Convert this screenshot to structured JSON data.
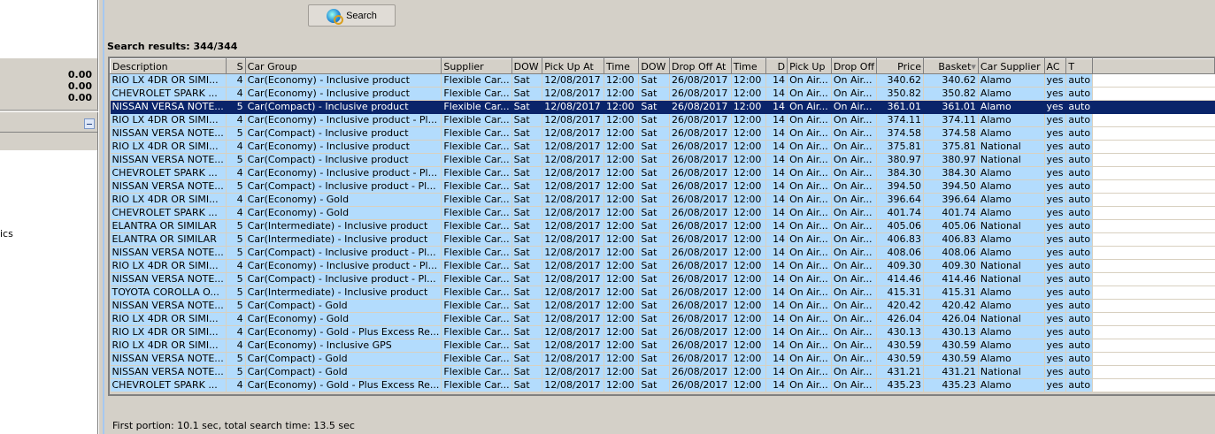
{
  "left_panel": {
    "values": [
      "0.00",
      "0.00",
      "0.00"
    ],
    "partial_label": "ics"
  },
  "toolbar": {
    "search_label": "Search",
    "search_icon": "globe-search-icon"
  },
  "results": {
    "label": "Search results: 344/344"
  },
  "table": {
    "columns": [
      "Description",
      "S",
      "Car Group",
      "Supplier",
      "DOW",
      "Pick Up At",
      "Time",
      "DOW",
      "Drop Off At",
      "Time",
      "D",
      "Pick Up",
      "Drop Off",
      "Price",
      "Basket",
      "Car Supplier",
      "AC",
      "T"
    ],
    "sorted_column": "Basket",
    "selected_row": 2,
    "rows": [
      [
        "RIO LX 4DR OR SIMI...",
        "4",
        "Car(Economy) - Inclusive product",
        "Flexible Car...",
        "Sat",
        "12/08/2017",
        "12:00",
        "Sat",
        "26/08/2017",
        "12:00",
        "14",
        "On Air...",
        "On Air...",
        "340.62",
        "340.62",
        "Alamo",
        "yes",
        "auto"
      ],
      [
        "CHEVROLET SPARK ...",
        "4",
        "Car(Economy) - Inclusive product",
        "Flexible Car...",
        "Sat",
        "12/08/2017",
        "12:00",
        "Sat",
        "26/08/2017",
        "12:00",
        "14",
        "On Air...",
        "On Air...",
        "350.82",
        "350.82",
        "Alamo",
        "yes",
        "auto"
      ],
      [
        "NISSAN VERSA NOTE...",
        "5",
        "Car(Compact) - Inclusive product",
        "Flexible Car...",
        "Sat",
        "12/08/2017",
        "12:00",
        "Sat",
        "26/08/2017",
        "12:00",
        "14",
        "On Air...",
        "On Air...",
        "361.01",
        "361.01",
        "Alamo",
        "yes",
        "auto"
      ],
      [
        "RIO LX 4DR OR SIMI...",
        "4",
        "Car(Economy) - Inclusive product - Pl...",
        "Flexible Car...",
        "Sat",
        "12/08/2017",
        "12:00",
        "Sat",
        "26/08/2017",
        "12:00",
        "14",
        "On Air...",
        "On Air...",
        "374.11",
        "374.11",
        "Alamo",
        "yes",
        "auto"
      ],
      [
        "NISSAN VERSA NOTE...",
        "5",
        "Car(Compact) - Inclusive product",
        "Flexible Car...",
        "Sat",
        "12/08/2017",
        "12:00",
        "Sat",
        "26/08/2017",
        "12:00",
        "14",
        "On Air...",
        "On Air...",
        "374.58",
        "374.58",
        "Alamo",
        "yes",
        "auto"
      ],
      [
        "RIO LX 4DR OR SIMI...",
        "4",
        "Car(Economy) - Inclusive product",
        "Flexible Car...",
        "Sat",
        "12/08/2017",
        "12:00",
        "Sat",
        "26/08/2017",
        "12:00",
        "14",
        "On Air...",
        "On Air...",
        "375.81",
        "375.81",
        "National",
        "yes",
        "auto"
      ],
      [
        "NISSAN VERSA NOTE...",
        "5",
        "Car(Compact) - Inclusive product",
        "Flexible Car...",
        "Sat",
        "12/08/2017",
        "12:00",
        "Sat",
        "26/08/2017",
        "12:00",
        "14",
        "On Air...",
        "On Air...",
        "380.97",
        "380.97",
        "National",
        "yes",
        "auto"
      ],
      [
        "CHEVROLET SPARK ...",
        "4",
        "Car(Economy) - Inclusive product - Pl...",
        "Flexible Car...",
        "Sat",
        "12/08/2017",
        "12:00",
        "Sat",
        "26/08/2017",
        "12:00",
        "14",
        "On Air...",
        "On Air...",
        "384.30",
        "384.30",
        "Alamo",
        "yes",
        "auto"
      ],
      [
        "NISSAN VERSA NOTE...",
        "5",
        "Car(Compact) - Inclusive product - Pl...",
        "Flexible Car...",
        "Sat",
        "12/08/2017",
        "12:00",
        "Sat",
        "26/08/2017",
        "12:00",
        "14",
        "On Air...",
        "On Air...",
        "394.50",
        "394.50",
        "Alamo",
        "yes",
        "auto"
      ],
      [
        "RIO LX 4DR OR SIMI...",
        "4",
        "Car(Economy) - Gold",
        "Flexible Car...",
        "Sat",
        "12/08/2017",
        "12:00",
        "Sat",
        "26/08/2017",
        "12:00",
        "14",
        "On Air...",
        "On Air...",
        "396.64",
        "396.64",
        "Alamo",
        "yes",
        "auto"
      ],
      [
        "CHEVROLET SPARK ...",
        "4",
        "Car(Economy) - Gold",
        "Flexible Car...",
        "Sat",
        "12/08/2017",
        "12:00",
        "Sat",
        "26/08/2017",
        "12:00",
        "14",
        "On Air...",
        "On Air...",
        "401.74",
        "401.74",
        "Alamo",
        "yes",
        "auto"
      ],
      [
        "ELANTRA OR SIMILAR",
        "5",
        "Car(Intermediate) - Inclusive product",
        "Flexible Car...",
        "Sat",
        "12/08/2017",
        "12:00",
        "Sat",
        "26/08/2017",
        "12:00",
        "14",
        "On Air...",
        "On Air...",
        "405.06",
        "405.06",
        "National",
        "yes",
        "auto"
      ],
      [
        "ELANTRA OR SIMILAR",
        "5",
        "Car(Intermediate) - Inclusive product",
        "Flexible Car...",
        "Sat",
        "12/08/2017",
        "12:00",
        "Sat",
        "26/08/2017",
        "12:00",
        "14",
        "On Air...",
        "On Air...",
        "406.83",
        "406.83",
        "Alamo",
        "yes",
        "auto"
      ],
      [
        "NISSAN VERSA NOTE...",
        "5",
        "Car(Compact) - Inclusive product - Pl...",
        "Flexible Car...",
        "Sat",
        "12/08/2017",
        "12:00",
        "Sat",
        "26/08/2017",
        "12:00",
        "14",
        "On Air...",
        "On Air...",
        "408.06",
        "408.06",
        "Alamo",
        "yes",
        "auto"
      ],
      [
        "RIO LX 4DR OR SIMI...",
        "4",
        "Car(Economy) - Inclusive product - Pl...",
        "Flexible Car...",
        "Sat",
        "12/08/2017",
        "12:00",
        "Sat",
        "26/08/2017",
        "12:00",
        "14",
        "On Air...",
        "On Air...",
        "409.30",
        "409.30",
        "National",
        "yes",
        "auto"
      ],
      [
        "NISSAN VERSA NOTE...",
        "5",
        "Car(Compact) - Inclusive product - Pl...",
        "Flexible Car...",
        "Sat",
        "12/08/2017",
        "12:00",
        "Sat",
        "26/08/2017",
        "12:00",
        "14",
        "On Air...",
        "On Air...",
        "414.46",
        "414.46",
        "National",
        "yes",
        "auto"
      ],
      [
        "TOYOTA COROLLA O...",
        "5",
        "Car(Intermediate) - Inclusive product",
        "Flexible Car...",
        "Sat",
        "12/08/2017",
        "12:00",
        "Sat",
        "26/08/2017",
        "12:00",
        "14",
        "On Air...",
        "On Air...",
        "415.31",
        "415.31",
        "Alamo",
        "yes",
        "auto"
      ],
      [
        "NISSAN VERSA NOTE...",
        "5",
        "Car(Compact) - Gold",
        "Flexible Car...",
        "Sat",
        "12/08/2017",
        "12:00",
        "Sat",
        "26/08/2017",
        "12:00",
        "14",
        "On Air...",
        "On Air...",
        "420.42",
        "420.42",
        "Alamo",
        "yes",
        "auto"
      ],
      [
        "RIO LX 4DR OR SIMI...",
        "4",
        "Car(Economy) - Gold",
        "Flexible Car...",
        "Sat",
        "12/08/2017",
        "12:00",
        "Sat",
        "26/08/2017",
        "12:00",
        "14",
        "On Air...",
        "On Air...",
        "426.04",
        "426.04",
        "National",
        "yes",
        "auto"
      ],
      [
        "RIO LX 4DR OR SIMI...",
        "4",
        "Car(Economy) - Gold - Plus Excess Re...",
        "Flexible Car...",
        "Sat",
        "12/08/2017",
        "12:00",
        "Sat",
        "26/08/2017",
        "12:00",
        "14",
        "On Air...",
        "On Air...",
        "430.13",
        "430.13",
        "Alamo",
        "yes",
        "auto"
      ],
      [
        "RIO LX 4DR OR SIMI...",
        "4",
        "Car(Economy) - Inclusive GPS",
        "Flexible Car...",
        "Sat",
        "12/08/2017",
        "12:00",
        "Sat",
        "26/08/2017",
        "12:00",
        "14",
        "On Air...",
        "On Air...",
        "430.59",
        "430.59",
        "Alamo",
        "yes",
        "auto"
      ],
      [
        "NISSAN VERSA NOTE...",
        "5",
        "Car(Compact) - Gold",
        "Flexible Car...",
        "Sat",
        "12/08/2017",
        "12:00",
        "Sat",
        "26/08/2017",
        "12:00",
        "14",
        "On Air...",
        "On Air...",
        "430.59",
        "430.59",
        "Alamo",
        "yes",
        "auto"
      ],
      [
        "NISSAN VERSA NOTE...",
        "5",
        "Car(Compact) - Gold",
        "Flexible Car...",
        "Sat",
        "12/08/2017",
        "12:00",
        "Sat",
        "26/08/2017",
        "12:00",
        "14",
        "On Air...",
        "On Air...",
        "431.21",
        "431.21",
        "National",
        "yes",
        "auto"
      ],
      [
        "CHEVROLET SPARK ...",
        "4",
        "Car(Economy) - Gold - Plus Excess Re...",
        "Flexible Car...",
        "Sat",
        "12/08/2017",
        "12:00",
        "Sat",
        "26/08/2017",
        "12:00",
        "14",
        "On Air...",
        "On Air...",
        "435.23",
        "435.23",
        "Alamo",
        "yes",
        "auto"
      ]
    ]
  },
  "status": {
    "text": "First portion: 10.1 sec, total search time: 13.5 sec"
  }
}
